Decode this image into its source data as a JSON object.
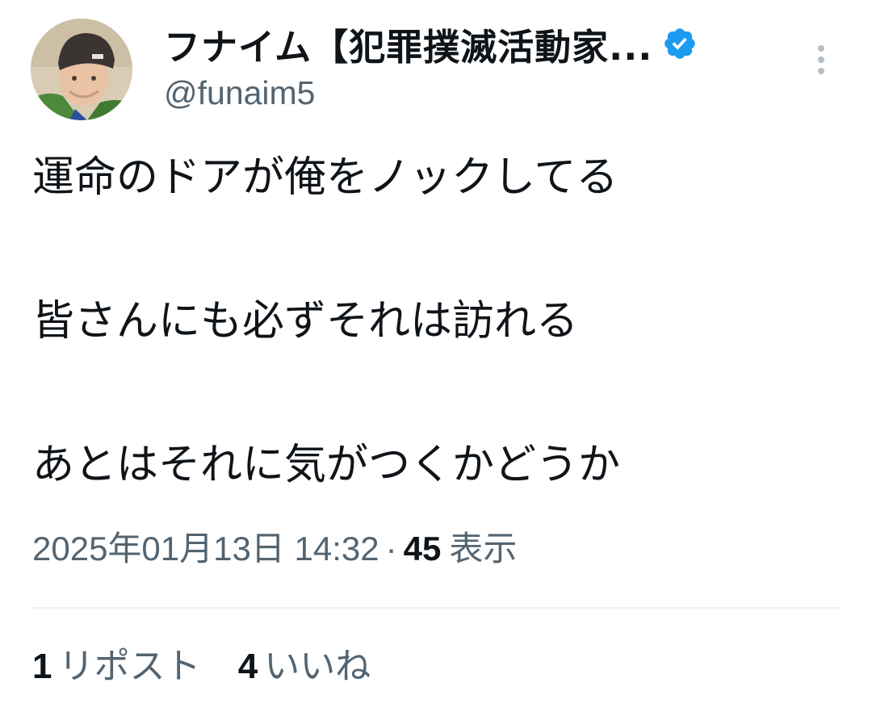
{
  "author": {
    "display_name": "フナイム【犯罪撲滅活動家...",
    "handle": "@funaim5",
    "verified": true
  },
  "icons": {
    "verified": "verified-badge-icon",
    "more": "more-vertical-icon"
  },
  "colors": {
    "accent": "#1d9bf0",
    "muted": "#536471",
    "text": "#0f1419"
  },
  "tweet": {
    "lines": [
      "運命のドアが俺をノックしてる",
      "皆さんにも必ずそれは訪れる",
      "あとはそれに気がつくかどうか"
    ],
    "timestamp": "2025年01月13日 14:32",
    "separator": "·",
    "views_count": "45",
    "views_label": "表示"
  },
  "stats": {
    "reposts_count": "1",
    "reposts_label": "リポスト",
    "likes_count": "4",
    "likes_label": "いいね"
  }
}
